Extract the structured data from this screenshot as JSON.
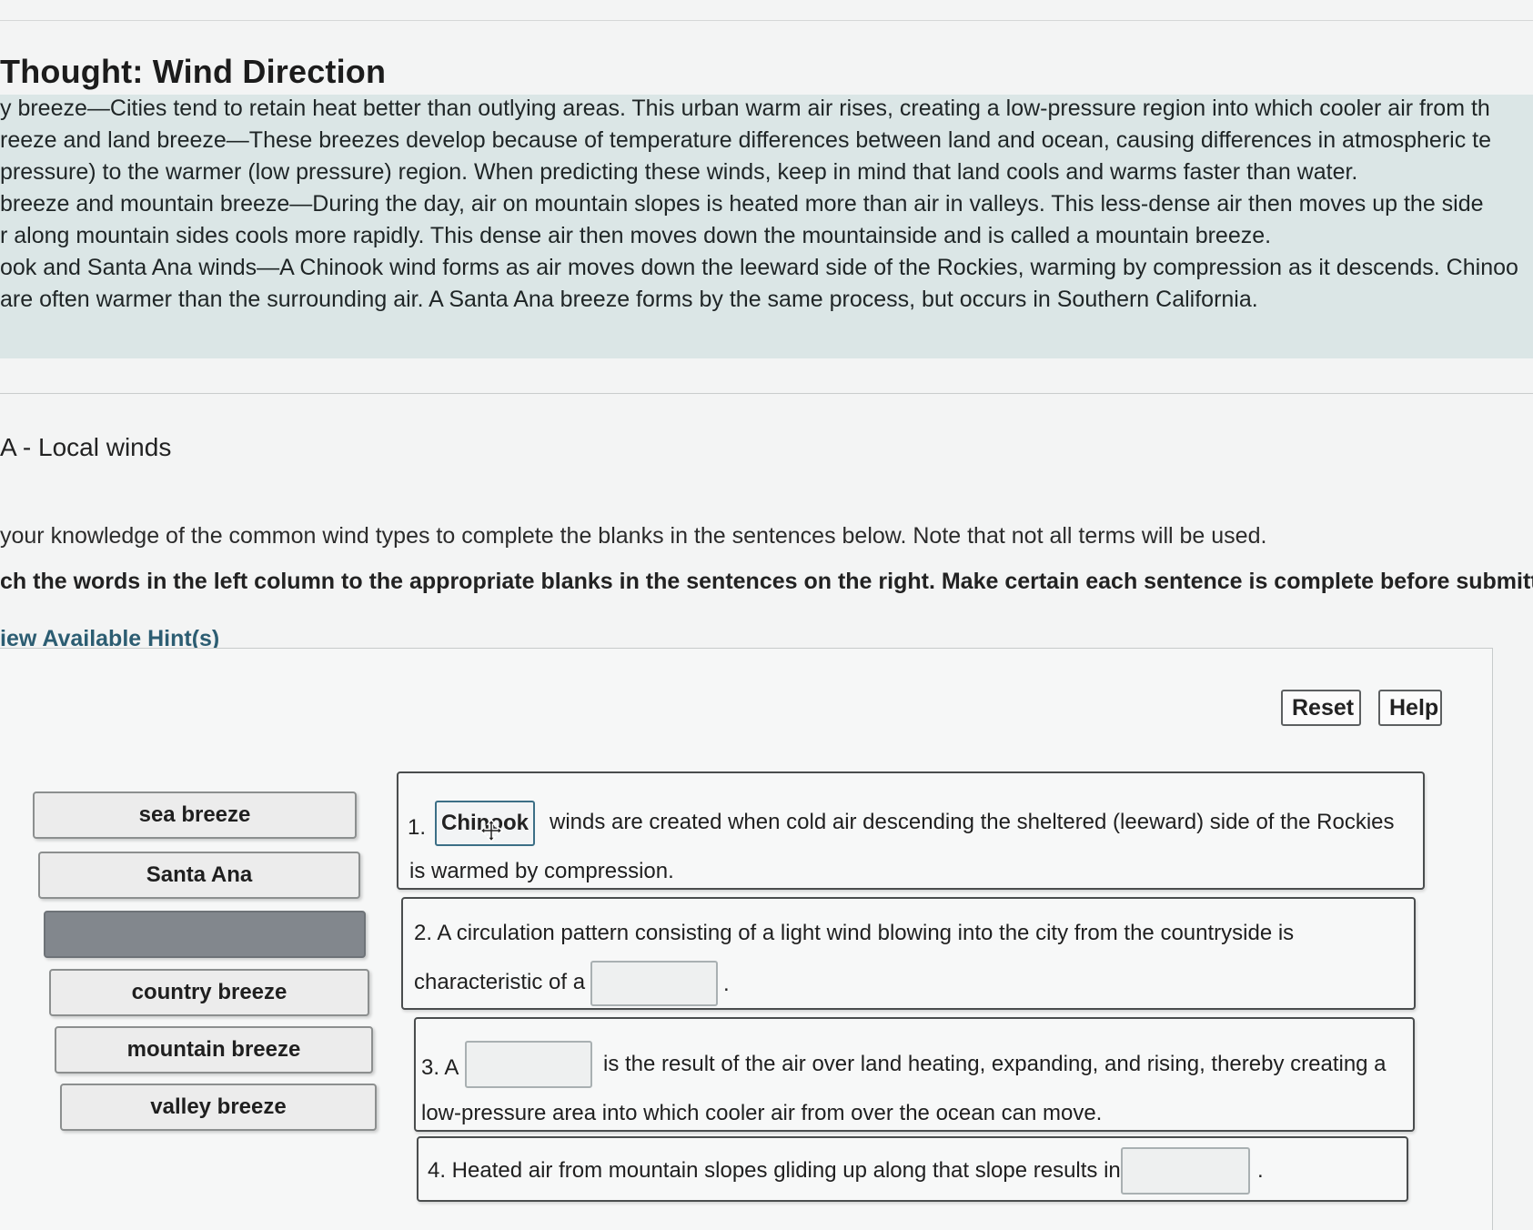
{
  "page": {
    "title": "Thought: Wind Direction"
  },
  "thought": {
    "lines": [
      "y breeze—Cities tend to retain heat better than outlying areas. This urban warm air rises, creating a low-pressure region into which cooler air from th",
      "reeze and land breeze—These breezes develop because of temperature differences between land and ocean, causing differences in atmospheric te",
      "pressure) to the warmer (low pressure) region. When predicting these winds, keep in mind that land cools and warms faster than water.",
      "breeze and mountain breeze—During the day, air on mountain slopes is heated more than air in valleys. This less-dense air then moves up the side",
      "r along mountain sides cools more rapidly. This dense air then moves down the mountainside and is called a mountain breeze.",
      "ook and Santa Ana winds—A Chinook wind forms as air moves down the leeward side of the Rockies, warming by compression as it descends. Chinoo",
      "are often warmer than the surrounding air. A Santa Ana breeze forms by the same process, but occurs in Southern California."
    ]
  },
  "part": {
    "heading": "A - Local winds",
    "instruction_1": "your knowledge of the common wind types to complete the blanks in the sentences below. Note that not all terms will be used.",
    "instruction_2": "ch the words in the left column to the appropriate blanks in the sentences on the right. Make certain each sentence is complete before submittin",
    "hint_link": "iew Available Hint(s)"
  },
  "toolbar": {
    "reset_label": "Reset",
    "help_label": "Help"
  },
  "word_bank": [
    {
      "label": "sea breeze",
      "empty": false
    },
    {
      "label": "Santa Ana",
      "empty": false
    },
    {
      "label": "",
      "empty": true
    },
    {
      "label": "country breeze",
      "empty": false
    },
    {
      "label": "mountain breeze",
      "empty": false
    },
    {
      "label": "valley breeze",
      "empty": false
    }
  ],
  "sentences": [
    {
      "prefix": "1.",
      "filled": "Chinook",
      "after": "winds are created when cold air descending the sheltered (leeward) side of the Rockies",
      "line2": "is warmed by compression."
    },
    {
      "line1": "2. A circulation pattern consisting of a light wind blowing into the city from the countryside is",
      "before": "characteristic of a",
      "after": "."
    },
    {
      "prefix": "3. A",
      "after": "is the result of the air over land heating, expanding, and rising, thereby creating a",
      "line2": "low-pressure area into which cooler air from over the ocean can move."
    },
    {
      "before": "4. Heated air from mountain slopes gliding up along that slope results in a",
      "after": "."
    }
  ]
}
